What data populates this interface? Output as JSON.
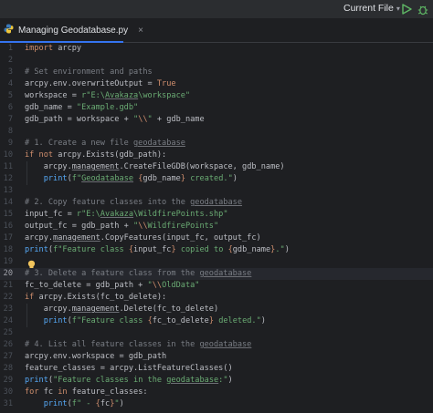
{
  "toolbar": {
    "run_config": "Current File",
    "chevron": "▾",
    "run_icon": "run-icon",
    "debug_icon": "debug-icon"
  },
  "tab": {
    "icon": "python-file-icon",
    "title": "Managing Geodatabase.py",
    "close": "×"
  },
  "editor": {
    "current_line": 20,
    "line_numbers": [
      "1",
      "2",
      "3",
      "4",
      "5",
      "6",
      "7",
      "8",
      "9",
      "10",
      "11",
      "12",
      "13",
      "14",
      "15",
      "16",
      "17",
      "18",
      "19",
      "20",
      "21",
      "22",
      "23",
      "24",
      "25",
      "26",
      "27",
      "28",
      "29",
      "30",
      "31"
    ],
    "lines": [
      "import arcpy",
      "",
      "# Set environment and paths",
      "arcpy.env.overwriteOutput = True",
      "workspace = r\"E:\\Avakaza\\workspace\"",
      "gdb_name = \"Example.gdb\"",
      "gdb_path = workspace + \"\\\\\" + gdb_name",
      "",
      "# 1. Create a new file geodatabase",
      "if not arcpy.Exists(gdb_path):",
      "    arcpy.management.CreateFileGDB(workspace, gdb_name)",
      "    print(f\"Geodatabase {gdb_name} created.\")",
      "",
      "# 2. Copy feature classes into the geodatabase",
      "input_fc = r\"E:\\Avakaza\\WildfirePoints.shp\"",
      "output_fc = gdb_path + \"\\\\WildfirePoints\"",
      "arcpy.management.CopyFeatures(input_fc, output_fc)",
      "print(f\"Feature class {input_fc} copied to {gdb_name}.\")",
      "",
      "# 3. Delete a feature class from the geodatabase",
      "fc_to_delete = gdb_path + \"\\\\OldData\"",
      "if arcpy.Exists(fc_to_delete):",
      "    arcpy.management.Delete(fc_to_delete)",
      "    print(f\"Feature class {fc_to_delete} deleted.\")",
      "",
      "# 4. List all feature classes in the geodatabase",
      "arcpy.env.workspace = gdb_path",
      "feature_classes = arcpy.ListFeatureClasses()",
      "print(\"Feature classes in the geodatabase:\")",
      "for fc in feature_classes:",
      "    print(f\" - {fc}\")"
    ]
  },
  "colors": {
    "background": "#1e1f22",
    "keyword": "#cf8e6d",
    "string": "#6aab73",
    "comment": "#7a7e85",
    "function": "#56a8f5",
    "accent": "#3574f0",
    "run_green": "#5fb865"
  }
}
